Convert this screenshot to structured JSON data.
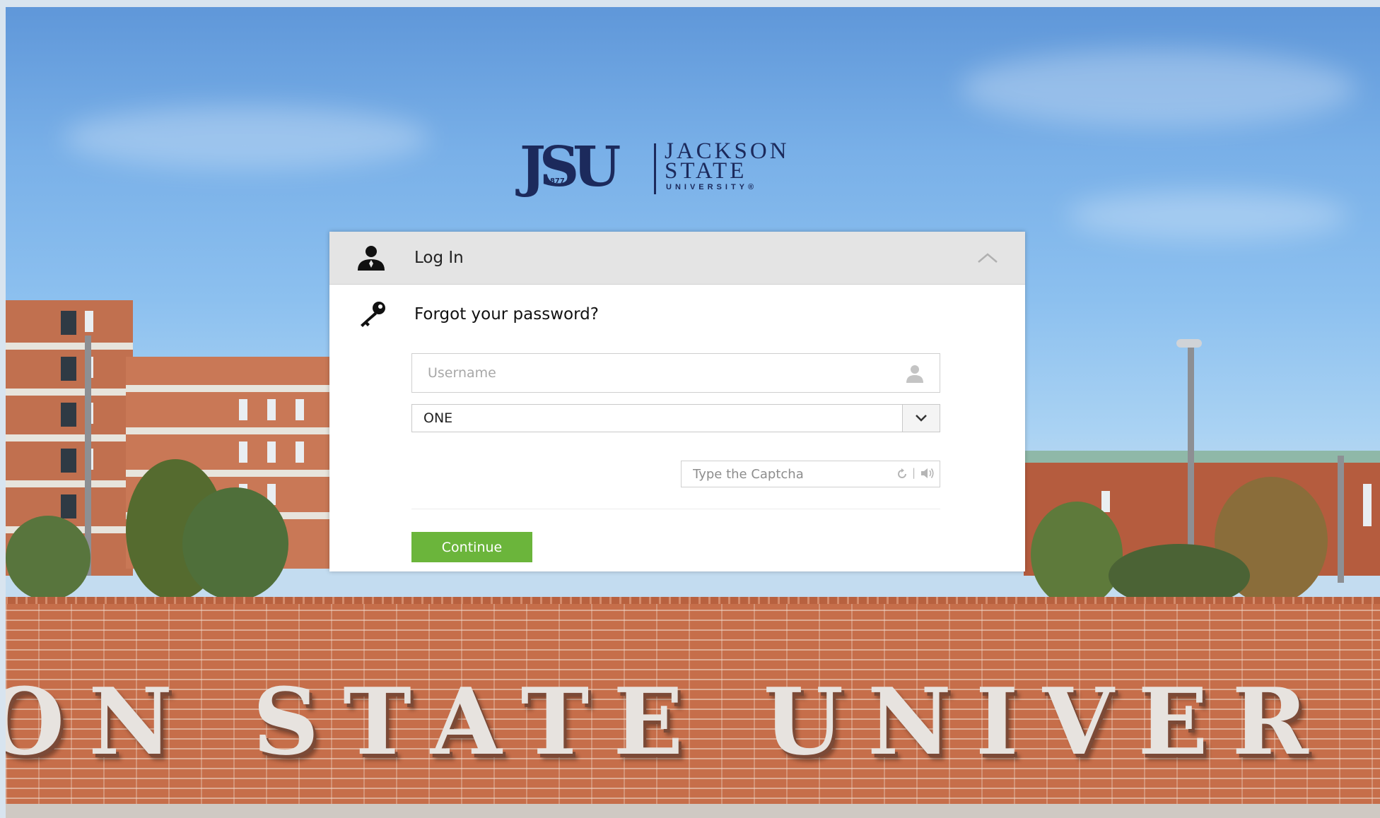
{
  "logo": {
    "monogram": "JSU",
    "year": "1877",
    "line1": "JACKSON",
    "line2": "STATE",
    "line3": "UNIVERSITY®"
  },
  "login_panel": {
    "header_label": "Log In",
    "forgot_label": "Forgot your password?",
    "username_placeholder": "Username",
    "domain_selected": "ONE",
    "captcha_placeholder": "Type the Captcha",
    "captcha_separator": "|",
    "continue_label": "Continue"
  },
  "background": {
    "wall_lettering": "ON STATE UNIVER"
  },
  "colors": {
    "accent_green": "#6bb53b",
    "logo_navy": "#1c2a5c",
    "header_gray": "#e4e4e4"
  },
  "icons": {
    "header": "user-icon",
    "forgot": "key-icon",
    "collapse": "chevron-up-icon",
    "username": "person-icon",
    "select": "chevron-down-icon",
    "captcha_refresh": "refresh-icon",
    "captcha_audio": "audio-icon"
  }
}
